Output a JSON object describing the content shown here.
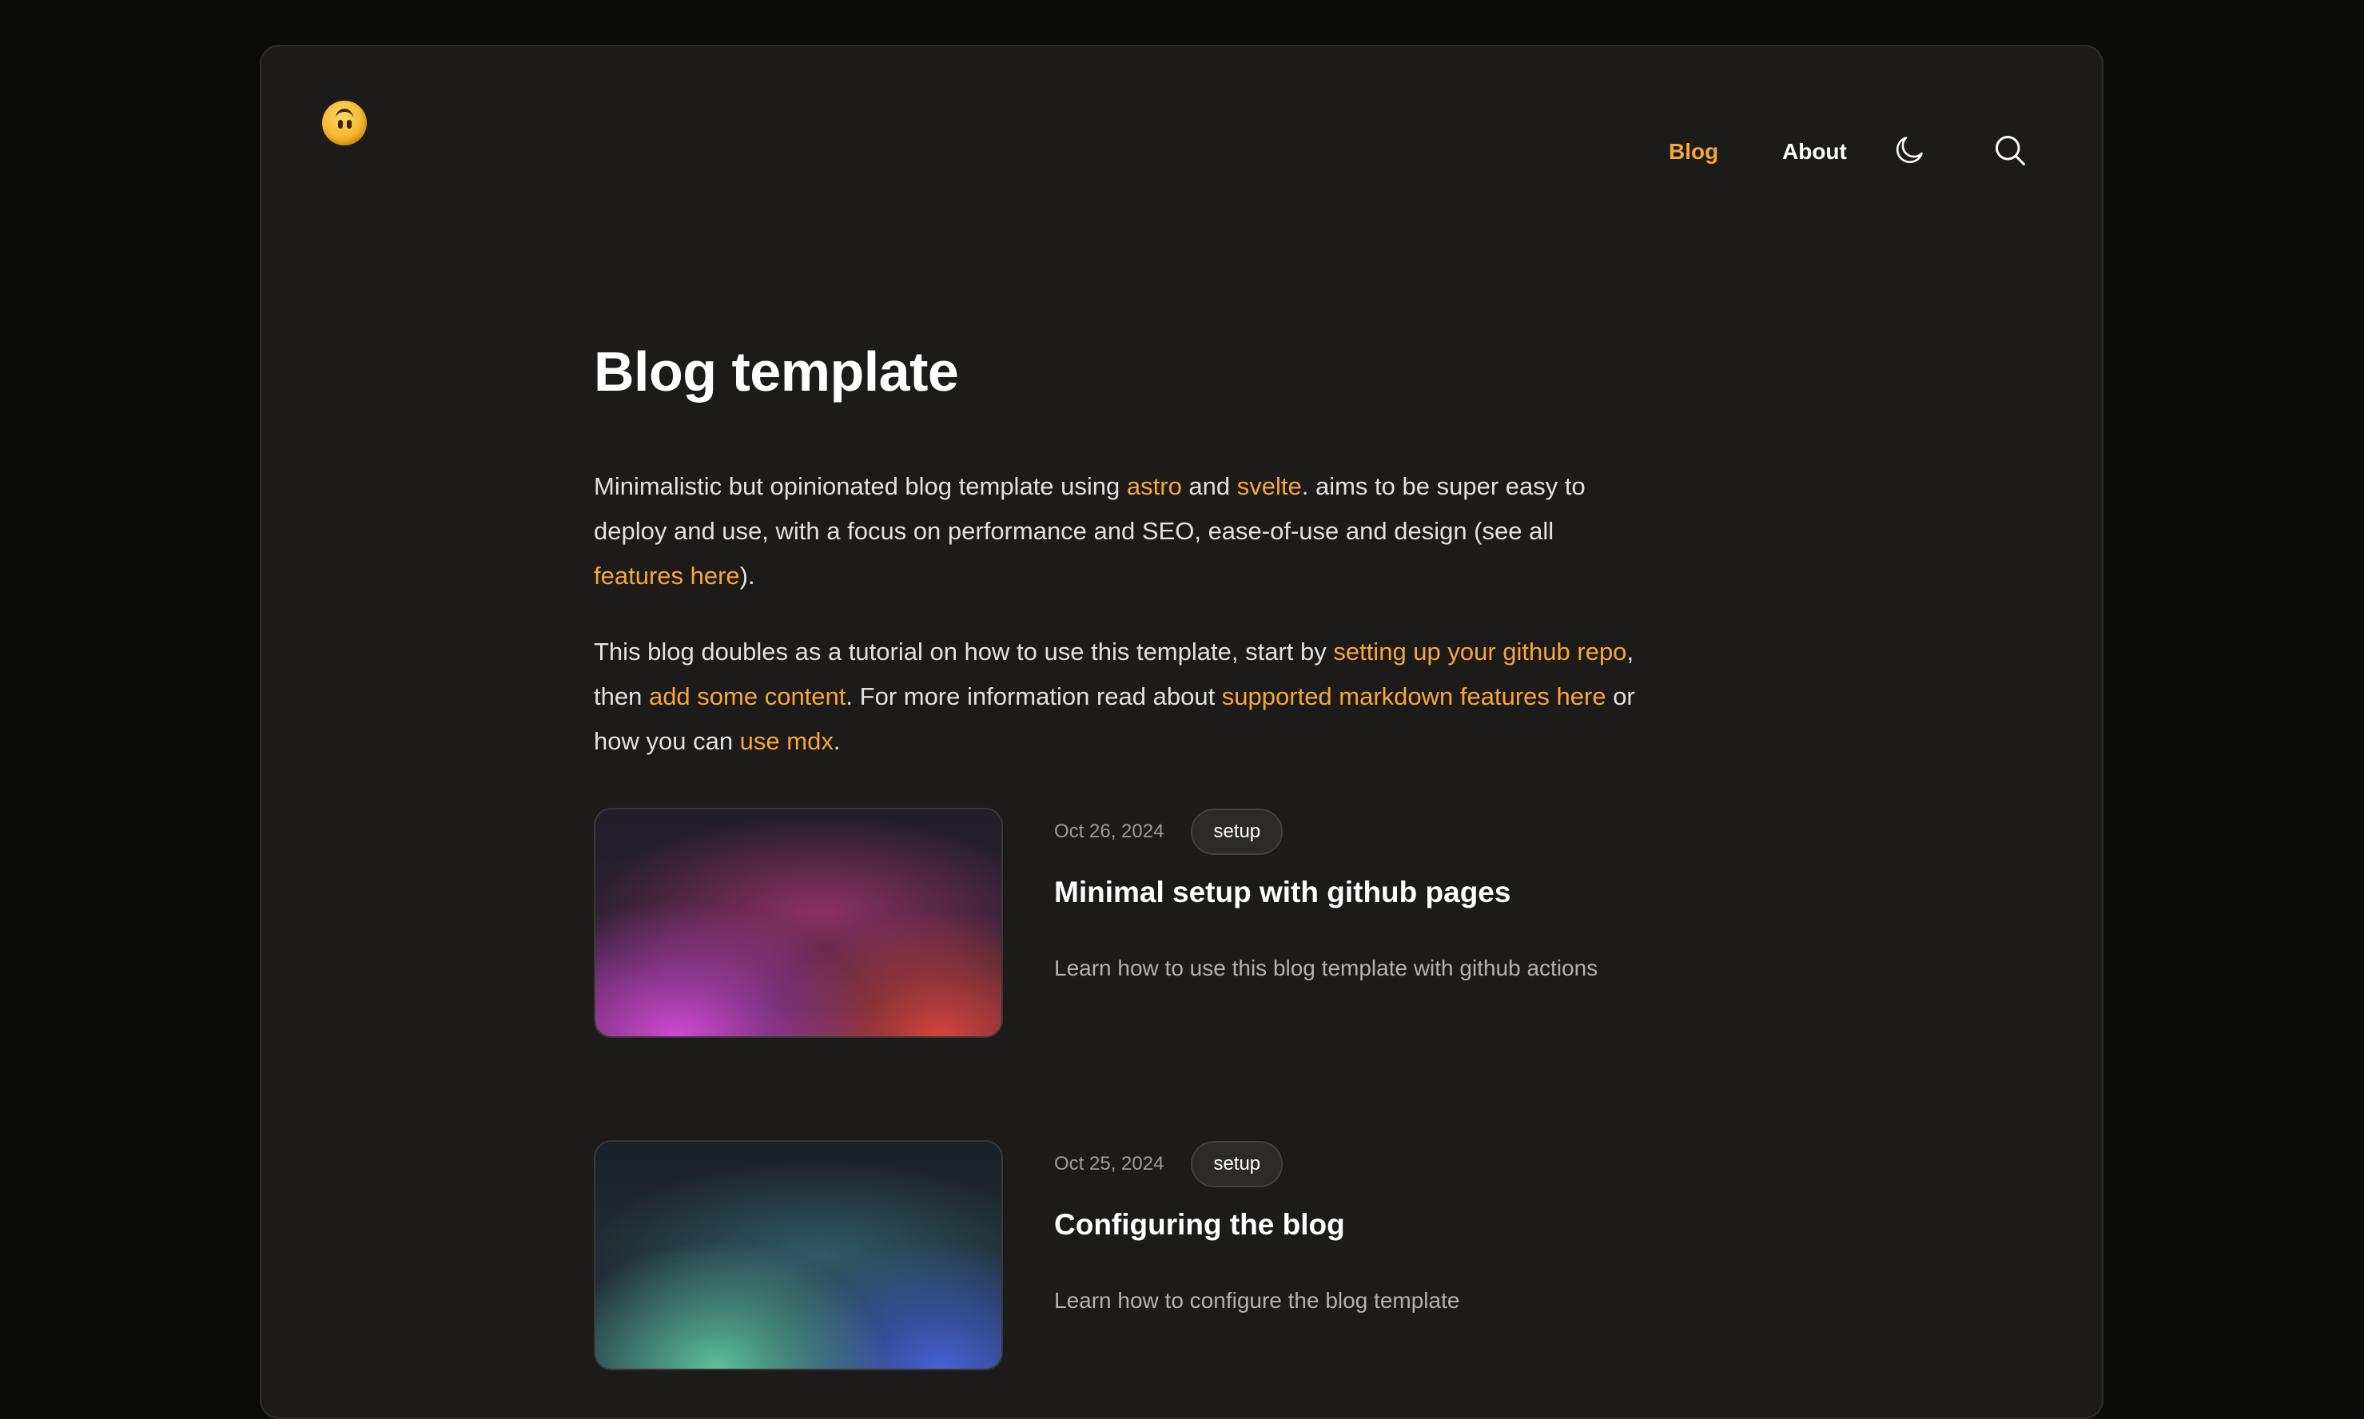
{
  "header": {
    "logo_icon": "upside-down-face-emoji",
    "nav": [
      {
        "label": "Blog",
        "active": true
      },
      {
        "label": "About",
        "active": false
      }
    ],
    "theme_toggle_icon": "moon-icon",
    "search_icon": "search-icon"
  },
  "intro": {
    "title": "Blog template",
    "p1": {
      "t1": "Minimalistic but opinionated blog template using ",
      "link_astro": "astro",
      "t2": " and ",
      "link_svelte": "svelte",
      "t3": ". aims to be super easy to deploy and use, with a focus on performance and SEO, ease-of-use and design (see all ",
      "link_features": "features here",
      "t4": ")."
    },
    "p2": {
      "t1": "This blog doubles as a tutorial on how to use this template, start by ",
      "link_setup": "setting up your github repo",
      "t2": ", then ",
      "link_content": "add some content",
      "t3": ". For more information read about ",
      "link_markdown": "supported markdown features here",
      "t4": " or how you can ",
      "link_mdx": "use mdx",
      "t5": "."
    }
  },
  "posts": [
    {
      "date": "Oct 26, 2024",
      "tag": "setup",
      "title": "Minimal setup with github pages",
      "description": "Learn how to use this blog template with github actions"
    },
    {
      "date": "Oct 25, 2024",
      "tag": "setup",
      "title": "Configuring the blog",
      "description": "Learn how to configure the blog template"
    }
  ],
  "colors": {
    "accent": "#f6a63a",
    "page_background": "#0b0b0a",
    "card_background": "#1c1b1a"
  }
}
